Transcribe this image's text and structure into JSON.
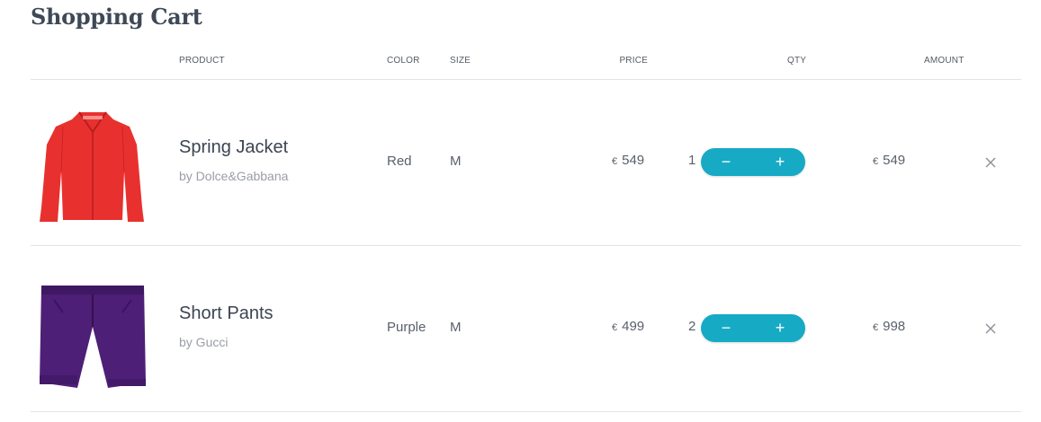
{
  "page": {
    "title": "Shopping Cart"
  },
  "headers": {
    "product": "PRODUCT",
    "color": "COLOR",
    "size": "SIZE",
    "price": "PRICE",
    "qty": "QTY",
    "amount": "AMOUNT"
  },
  "currency": "€",
  "items": [
    {
      "name": "Spring Jacket",
      "brand": "by Dolce&Gabbana",
      "color": "Red",
      "size": "M",
      "price": "549",
      "qty": "1",
      "amount": "549",
      "image": "red-jacket",
      "image_color": "#e8312f"
    },
    {
      "name": "Short Pants",
      "brand": "by Gucci",
      "color": "Purple",
      "size": "M",
      "price": "499",
      "qty": "2",
      "amount": "998",
      "image": "purple-shorts",
      "image_color": "#4e1f77"
    }
  ],
  "controls": {
    "minus": "−",
    "plus": "+"
  },
  "colors": {
    "accent": "#16aac5",
    "divider": "#e3e4e6",
    "text": "#3c4452",
    "muted": "#9a9ea6"
  }
}
